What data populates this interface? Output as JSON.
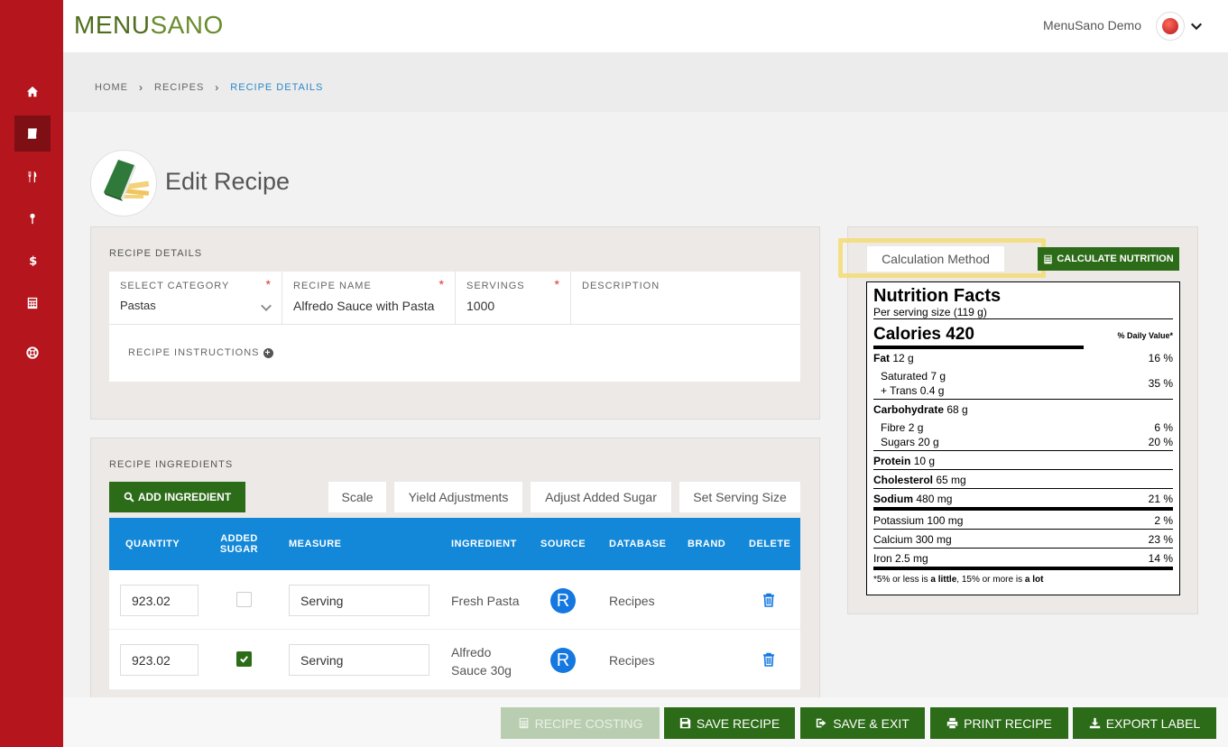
{
  "app": {
    "logo_prefix": "MENU",
    "logo_suffix": "SANO",
    "user_name": "MenuSano Demo"
  },
  "breadcrumb": {
    "home": "HOME",
    "recipes": "RECIPES",
    "current": "RECIPE DETAILS"
  },
  "page": {
    "title": "Edit Recipe"
  },
  "sidebar": {
    "items": [
      "home-icon",
      "book-icon",
      "utensils-icon",
      "cocktail-icon",
      "dollar-icon",
      "calculator-icon",
      "life-ring-icon"
    ]
  },
  "recipe_details": {
    "section_label": "RECIPE DETAILS",
    "category_label": "SELECT CATEGORY",
    "category_value": "Pastas",
    "name_label": "RECIPE NAME",
    "name_value": "Alfredo Sauce with Pasta",
    "servings_label": "SERVINGS",
    "servings_value": "1000",
    "description_label": "DESCRIPTION",
    "description_value": "",
    "instructions_label": "RECIPE INSTRUCTIONS",
    "required_mark": "*"
  },
  "ingredients": {
    "section_label": "RECIPE INGREDIENTS",
    "add_button": "ADD INGREDIENT",
    "scale_button": "Scale",
    "yield_button": "Yield Adjustments",
    "sugar_button": "Adjust Added Sugar",
    "serving_button": "Set Serving Size",
    "headers": {
      "quantity": "QUANTITY",
      "added_sugar_1": "ADDED",
      "added_sugar_2": "SUGAR",
      "measure": "MEASURE",
      "ingredient": "INGREDIENT",
      "source": "SOURCE",
      "database": "DATABASE",
      "brand": "BRAND",
      "delete": "DELETE"
    },
    "rows": [
      {
        "quantity": "923.02",
        "added_sugar": false,
        "measure": "Serving",
        "ingredient_1": "Fresh Pasta",
        "ingredient_2": "",
        "source": "R",
        "database": "Recipes",
        "brand": ""
      },
      {
        "quantity": "923.02",
        "added_sugar": true,
        "measure": "Serving",
        "ingredient_1": "Alfredo",
        "ingredient_2": "Sauce 30g",
        "source": "R",
        "database": "Recipes",
        "brand": ""
      }
    ]
  },
  "nutrition": {
    "calc_method": "Calculation Method",
    "calc_button": "CALCULATE NUTRITION",
    "title": "Nutrition Facts",
    "serving": "Per serving size (119 g)",
    "calories_label": "Calories",
    "calories_value": "420",
    "dv_header": "% Daily Value*",
    "fat_label": "Fat",
    "fat_value": "12 g",
    "fat_dv": "16 %",
    "sat_label": "Saturated",
    "sat_value": "7 g",
    "trans_label": "+ Trans",
    "trans_value": "0.4 g",
    "sat_trans_dv": "35 %",
    "carb_label": "Carbohydrate",
    "carb_value": "68 g",
    "fibre_label": "Fibre",
    "fibre_value": "2 g",
    "fibre_dv": "6 %",
    "sugars_label": "Sugars",
    "sugars_value": "20 g",
    "sugars_dv": "20 %",
    "protein_label": "Protein",
    "protein_value": "10 g",
    "chol_label": "Cholesterol",
    "chol_value": "65 mg",
    "sodium_label": "Sodium",
    "sodium_value": "480 mg",
    "sodium_dv": "21 %",
    "potassium_label": "Potassium",
    "potassium_value": "100 mg",
    "potassium_dv": "2 %",
    "calcium_label": "Calcium",
    "calcium_value": "300 mg",
    "calcium_dv": "23 %",
    "iron_label": "Iron",
    "iron_value": "2.5 mg",
    "iron_dv": "14 %",
    "foot_1": "*5% or less is ",
    "foot_2": "a little",
    "foot_3": ", 15% or more is ",
    "foot_4": "a lot"
  },
  "footer": {
    "costing": "RECIPE COSTING",
    "save": "SAVE RECIPE",
    "save_exit": "SAVE & EXIT",
    "print": "PRINT RECIPE",
    "export": "EXPORT LABEL"
  },
  "colors": {
    "sidebar": "#b5151d",
    "accent_green": "#2c6b18",
    "table_blue": "#1488d8",
    "breadcrumb_link": "#2b88c8"
  }
}
